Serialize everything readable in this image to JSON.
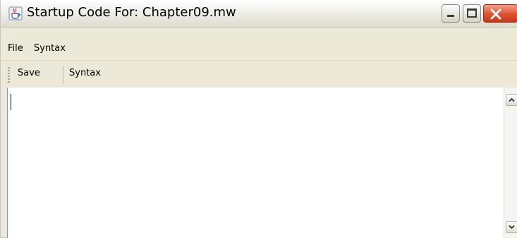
{
  "window": {
    "title": "Startup Code For:  Chapter09.mw",
    "icon": "java-cup-icon",
    "controls": [
      "minimize-icon",
      "maximize-icon",
      "close-icon"
    ]
  },
  "menu": {
    "items": [
      "File",
      "Syntax"
    ]
  },
  "toolbar": {
    "buttons": [
      "Save",
      "Syntax"
    ]
  },
  "editor": {
    "text": ""
  },
  "colors": {
    "close_button": "#e0512f",
    "editor_background": "#ffffff",
    "chrome": "#ece9d8"
  }
}
